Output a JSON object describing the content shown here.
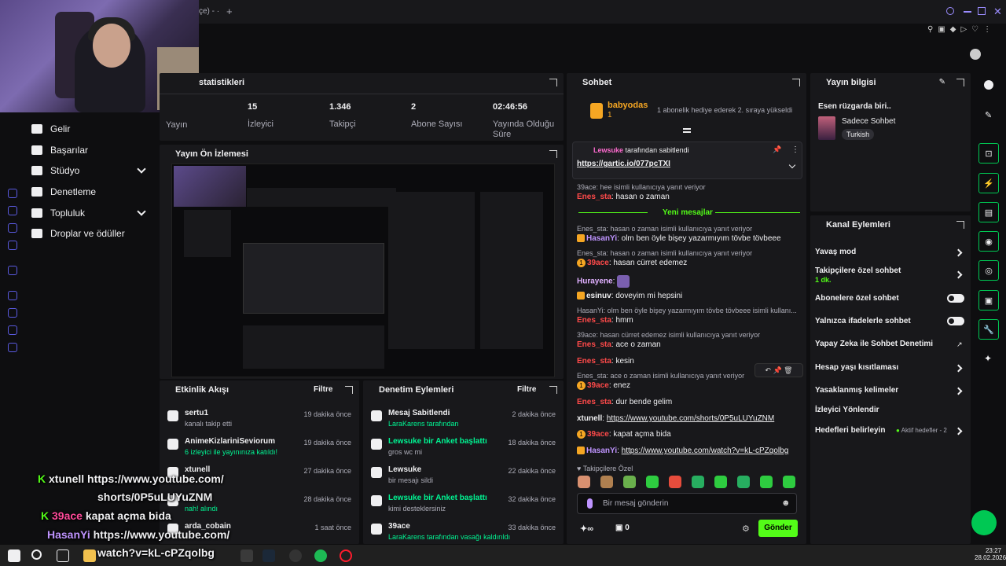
{
  "titlebar": {
    "tab_text": "çe) - ·",
    "new_tab": "+"
  },
  "sidebar": {
    "items": [
      {
        "label": "Gelir"
      },
      {
        "label": "Başarılar"
      },
      {
        "label": "Stüdyo"
      },
      {
        "label": "Denetleme"
      },
      {
        "label": "Topluluk"
      },
      {
        "label": "Droplar ve ödüller"
      }
    ]
  },
  "stats": {
    "title": "statistikleri",
    "items": [
      {
        "value": "",
        "label": "Yayın"
      },
      {
        "value": "15",
        "label": "İzleyici"
      },
      {
        "value": "1.346",
        "label": "Takipçi"
      },
      {
        "value": "2",
        "label": "Abone Sayısı"
      },
      {
        "value": "02:46:56",
        "label": "Yayında Olduğu Süre"
      }
    ]
  },
  "preview": {
    "title": "Yayın Ön İzlemesi"
  },
  "activity": {
    "title": "Etkinlik Akışı",
    "filter": "Filtre",
    "rows": [
      {
        "name": "sertu1",
        "desc": "kanalı takip etti",
        "time": "19 dakika önce",
        "green": false
      },
      {
        "name": "AnimeKizlariniSeviorum",
        "desc": "6 izleyici ile yayınınıza katıldı!",
        "time": "19 dakika önce",
        "green": true
      },
      {
        "name": "xtunell",
        "desc": "",
        "time": "27 dakika önce",
        "green": false
      },
      {
        "name": "",
        "desc": "nah! alındı",
        "time": "28 dakika önce",
        "green": true
      },
      {
        "name": "arda_cobain",
        "desc": "",
        "time": "1 saat önce",
        "green": false
      }
    ]
  },
  "moderation": {
    "title": "Denetim Eylemleri",
    "filter": "Filtre",
    "rows": [
      {
        "name": "Mesaj Sabitlendi",
        "desc": "LaraKarens tarafından",
        "time": "2 dakika önce"
      },
      {
        "name": "Lewsuke bir Anket başlattı",
        "desc": "gros wc mi",
        "time": "18 dakika önce"
      },
      {
        "name": "Lewsuke",
        "desc": "bir mesajı sildi",
        "time": "22 dakika önce"
      },
      {
        "name": "Lewsuke bir Anket başlattı",
        "desc": "kimi desteklersiniz",
        "time": "32 dakika önce"
      },
      {
        "name": "39ace",
        "desc": "LaraKarens tarafından vasağı kaldırıldı",
        "time": "33 dakika önce"
      }
    ]
  },
  "chat": {
    "title": "Sohbet",
    "top_user": "babyodas",
    "top_count": "1",
    "top_msg": "1 abonelik hediye ederek 2. sıraya yükseldi",
    "pinned_by": "Lewsuke",
    "pinned_by_suffix": "tarafından sabitlendi",
    "pinned_link": "https://gartic.io/077pcTXI",
    "new_messages": "Yeni mesajlar",
    "lines": [
      {
        "kind": "reply",
        "text": "39ace: hee isimli kullanıcıya yanıt veriyor"
      },
      {
        "kind": "msg",
        "user": "Enes_sta",
        "color": "red",
        "text": ": hasan o zaman"
      },
      {
        "kind": "reply",
        "text": "Enes_sta: hasan o zaman isimli kullanıcıya yanıt veriyor"
      },
      {
        "kind": "msg",
        "user": "HasanYi",
        "color": "purple",
        "text": ": olm ben öyle bişey yazarmıyım tövbe tövbeee"
      },
      {
        "kind": "reply",
        "text": "Enes_sta: hasan o zaman isimli kullanıcıya yanıt veriyor"
      },
      {
        "kind": "msg",
        "user": "39ace",
        "color": "red",
        "text": ": hasan cürret edemez"
      },
      {
        "kind": "msg",
        "user": "Hurayene",
        "color": "pink",
        "text": ":"
      },
      {
        "kind": "msg",
        "user": "esinuv",
        "color": "white",
        "text": ": doveyim mi hepsini"
      },
      {
        "kind": "reply",
        "text": "HasanYi: olm ben öyle bişey yazarmıyım tövbe tövbeee isimli kullanı..."
      },
      {
        "kind": "msg",
        "user": "Enes_sta",
        "color": "red",
        "text": ": hmm"
      },
      {
        "kind": "reply",
        "text": "39ace: hasan cürret edemez isimli kullanıcıya yanıt veriyor"
      },
      {
        "kind": "msg",
        "user": "Enes_sta",
        "color": "red",
        "text": ": ace o zaman"
      },
      {
        "kind": "msg",
        "user": "Enes_sta",
        "color": "red",
        "text": ": kesin"
      },
      {
        "kind": "reply",
        "text": "Enes_sta: ace o zaman isimli kullanıcıya yanıt veriyor"
      },
      {
        "kind": "msg",
        "user": "39ace",
        "color": "red",
        "text": ": enez"
      },
      {
        "kind": "msg",
        "user": "Enes_sta",
        "color": "red",
        "text": ": dur bende gelim"
      },
      {
        "kind": "link",
        "user": "xtunell",
        "color": "white",
        "text": "https://www.youtube.com/shorts/0P5uLUYuZNM"
      },
      {
        "kind": "msg",
        "user": "39ace",
        "color": "red",
        "text": ": kapat açma bida"
      },
      {
        "kind": "link",
        "user": "HasanYi",
        "color": "purple",
        "text": "https://www.youtube.com/watch?v=kL-cPZqolbg"
      }
    ],
    "followers_only": "Takipçilere Özel",
    "input_placeholder": "Bir mesaj gönderin",
    "points": "0",
    "send": "Gönder"
  },
  "stream_info": {
    "title": "Yayın bilgisi",
    "stream_title": "Esen rüzgarda biri..",
    "category": "Sadece Sohbet",
    "tag": "Turkish"
  },
  "channel_actions": {
    "title": "Kanal Eylemleri",
    "slow_mode": "Yavaş mod",
    "followers_chat": "Takipçilere özel sohbet",
    "followers_sub": "1 dk.",
    "sub_chat": "Abonelere özel sohbet",
    "emote_chat": "Yalnızca ifadelerle sohbet",
    "ai_mod": "Yapay Zeka ile Sohbet Denetimi",
    "age": "Hesap yaşı kısıtlaması",
    "banned_words": "Yasaklanmış kelimeler",
    "raid": "İzleyici Yönlendir",
    "goals": "Hedefleri belirleyin",
    "goals_active": "Aktif hedefler - 2"
  },
  "overlay": {
    "line1_user": "xtunell",
    "line1_text": "https://www.youtube.com/",
    "line1_cont": "shorts/0P5uLUYuZNM",
    "line2_user": "39ace",
    "line2_text": "kapat açma bida",
    "line3_user": "HasanYi",
    "line3_text": "https://www.youtube.com/",
    "line3_cont": "watch?v=kL-cPZqolbg"
  },
  "taskbar": {
    "time": "23:27",
    "date": "28.02.2026"
  },
  "colors": {
    "accent": "#53fc18",
    "bg": "#0e0e10",
    "panel": "#18181b",
    "red": "#ff4a4a",
    "purple": "#bf94ff"
  }
}
